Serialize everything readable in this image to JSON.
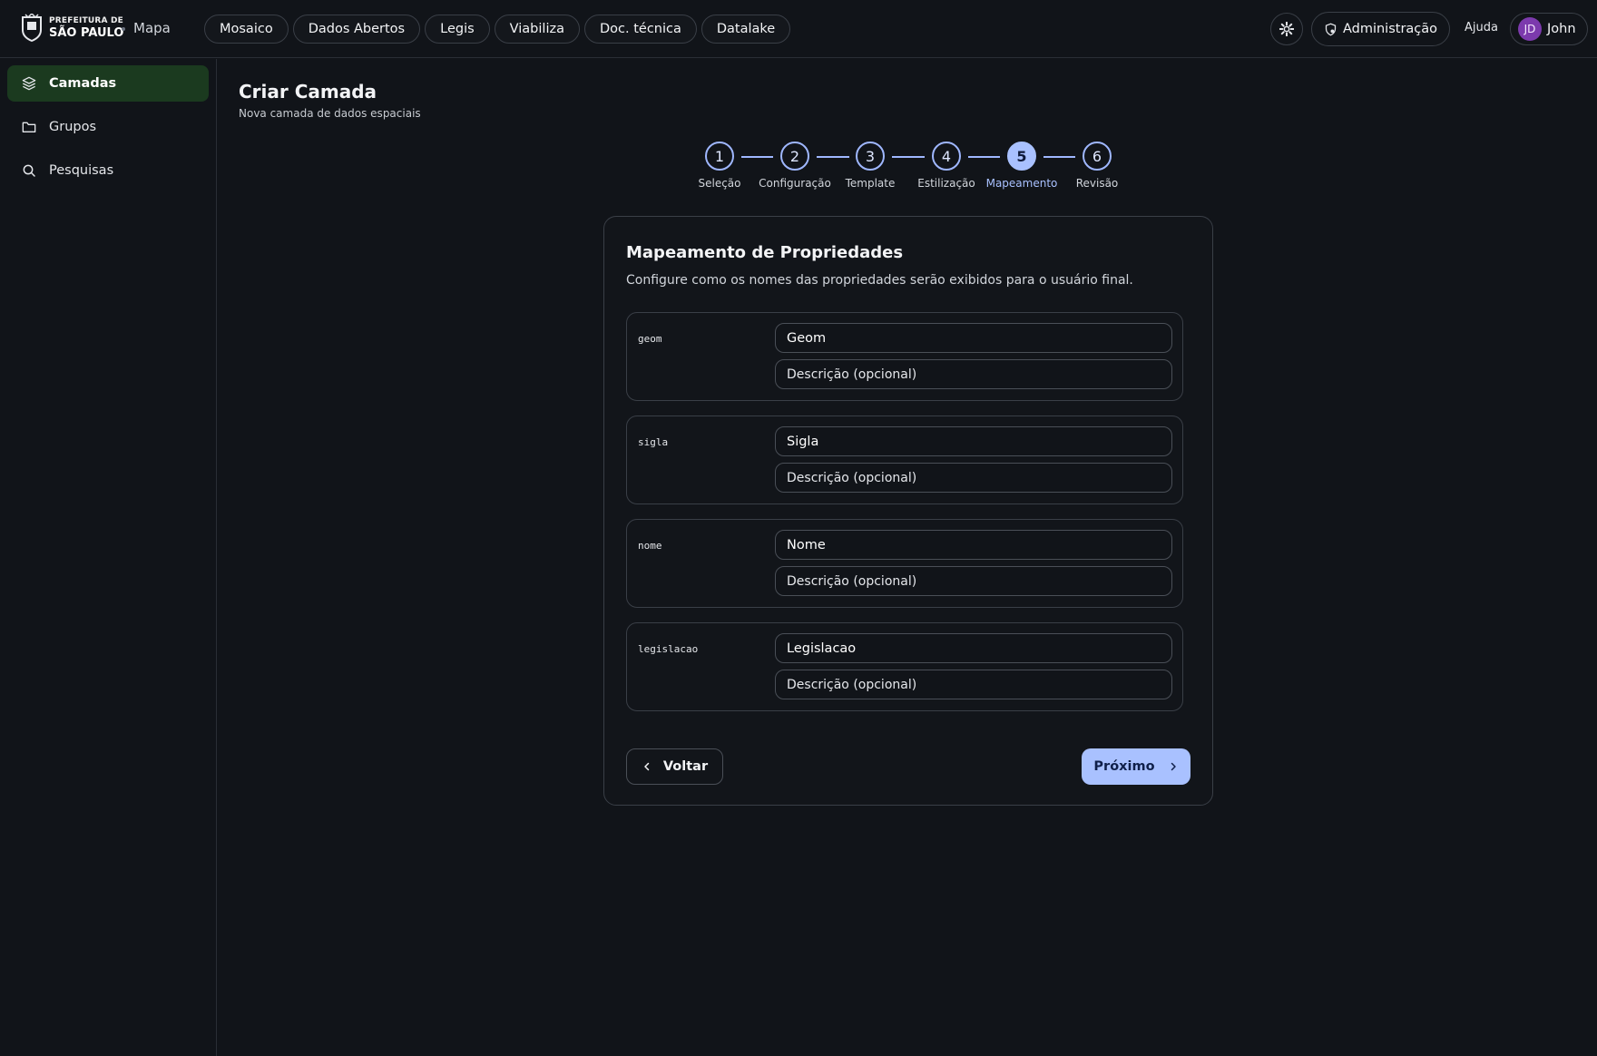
{
  "header": {
    "logo_line1": "PREFEITURA DE",
    "logo_line2": "SÃO PAULO",
    "app_name": "Mapa",
    "nav": [
      "Mosaico",
      "Dados Abertos",
      "Legis",
      "Viabiliza",
      "Doc. técnica",
      "Datalake"
    ],
    "admin_label": "Administração",
    "help_label": "Ajuda",
    "user_initials": "JD",
    "user_name": "John"
  },
  "sidebar": {
    "items": [
      {
        "label": "Camadas",
        "icon": "layers-icon",
        "active": true
      },
      {
        "label": "Grupos",
        "icon": "folder-icon",
        "active": false
      },
      {
        "label": "Pesquisas",
        "icon": "search-icon",
        "active": false
      }
    ]
  },
  "page": {
    "title": "Criar Camada",
    "subtitle": "Nova camada de dados espaciais"
  },
  "stepper": {
    "current": 5,
    "steps": [
      {
        "number": "1",
        "label": "Seleção"
      },
      {
        "number": "2",
        "label": "Configuração"
      },
      {
        "number": "3",
        "label": "Template"
      },
      {
        "number": "4",
        "label": "Estilização"
      },
      {
        "number": "5",
        "label": "Mapeamento"
      },
      {
        "number": "6",
        "label": "Revisão"
      }
    ]
  },
  "card": {
    "title": "Mapeamento de Propriedades",
    "description": "Configure como os nomes das propriedades serão exibidos para o usuário final.",
    "properties": [
      {
        "key": "geom",
        "name": "Geom",
        "description_placeholder": "Descrição (opcional)"
      },
      {
        "key": "sigla",
        "name": "Sigla",
        "description_placeholder": "Descrição (opcional)"
      },
      {
        "key": "nome",
        "name": "Nome",
        "description_placeholder": "Descrição (opcional)"
      },
      {
        "key": "legislacao",
        "name": "Legislacao",
        "description_placeholder": "Descrição (opcional)"
      }
    ],
    "back_label": "Voltar",
    "next_label": "Próximo"
  },
  "colors": {
    "accent": "#a9c1ff",
    "sidebar_active": "#1b3a1f",
    "avatar": "#7c3aad",
    "background": "#111419"
  }
}
